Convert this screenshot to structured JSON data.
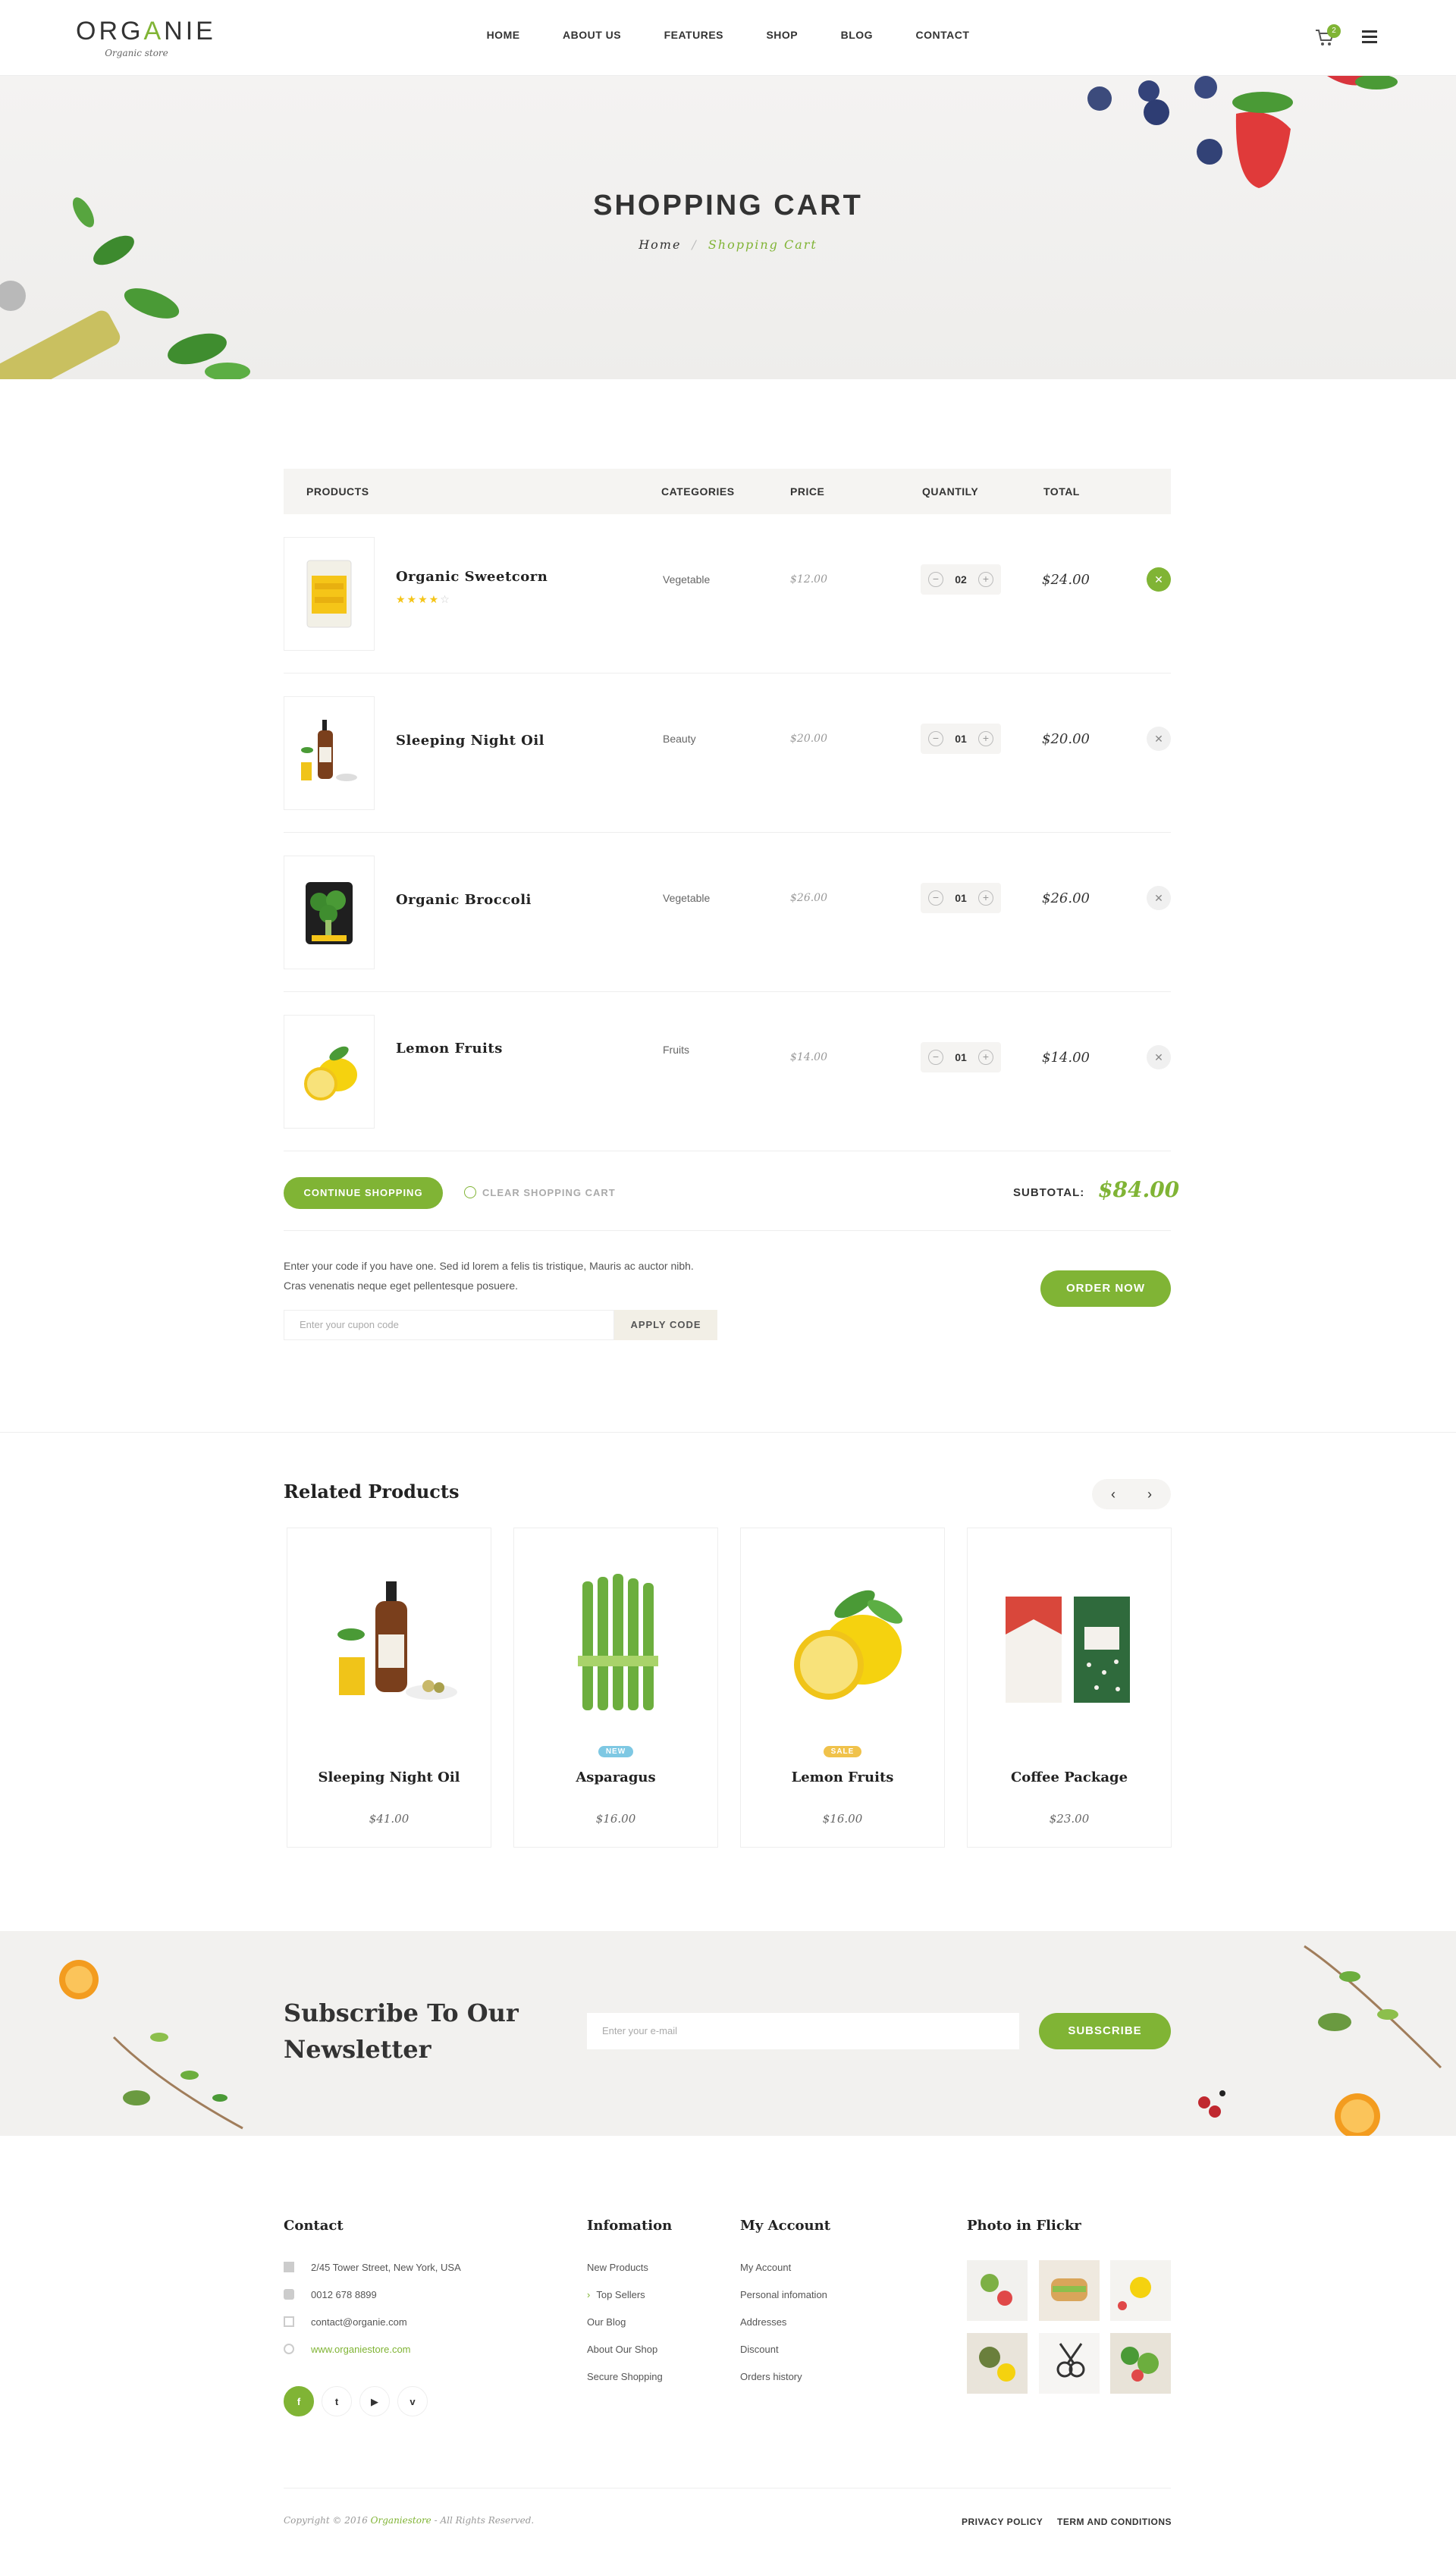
{
  "header": {
    "logo_part1": "ORG",
    "logo_accent": "A",
    "logo_part2": "NIE",
    "logo_tagline": "Organic store",
    "nav": [
      "HOME",
      "ABOUT US",
      "FEATURES",
      "SHOP",
      "BLOG",
      "CONTACT"
    ],
    "cart_count": "2"
  },
  "hero": {
    "title": "SHOPPING CART",
    "breadcrumb_home": "Home",
    "breadcrumb_sep": "/",
    "breadcrumb_current": "Shopping Cart"
  },
  "cart": {
    "columns": {
      "products": "PRODUCTS",
      "categories": "CATEGORIES",
      "price": "PRICE",
      "quantity": "QUANTILY",
      "total": "TOTAL"
    },
    "items": [
      {
        "name": "Organic Sweetcorn",
        "category": "Vegetable",
        "price": "$12.00",
        "qty": "02",
        "total": "$24.00",
        "rating": 4,
        "stars_on": "★★★★",
        "stars_off": "☆"
      },
      {
        "name": "Sleeping Night Oil",
        "category": "Beauty",
        "price": "$20.00",
        "qty": "01",
        "total": "$20.00"
      },
      {
        "name": "Organic Broccoli",
        "category": "Vegetable",
        "price": "$26.00",
        "qty": "01",
        "total": "$26.00"
      },
      {
        "name": "Lemon Fruits",
        "category": "Fruits",
        "price": "$14.00",
        "qty": "01",
        "total": "$14.00"
      }
    ],
    "continue_label": "CONTINUE SHOPPING",
    "clear_label": "CLEAR SHOPPING CART",
    "subtotal_label": "SUBTOTAL:",
    "subtotal_value": "$84.00",
    "coupon_text": "Enter your code if you have one. Sed id lorem a felis tis tristique, Mauris ac auctor nibh. Cras venenatis neque eget pellentesque posuere.",
    "coupon_placeholder": "Enter your cupon code",
    "apply_label": "APPLY CODE",
    "order_label": "ORDER NOW"
  },
  "related": {
    "title": "Related Products",
    "prev": "‹",
    "next": "›",
    "products": [
      {
        "name": "Sleeping Night Oil",
        "price": "$41.00",
        "badge": ""
      },
      {
        "name": "Asparagus",
        "price": "$16.00",
        "badge": "NEW"
      },
      {
        "name": "Lemon Fruits",
        "price": "$16.00",
        "badge": "SALE"
      },
      {
        "name": "Coffee Package",
        "price": "$23.00",
        "badge": ""
      }
    ]
  },
  "newsletter": {
    "title": "Subscribe To Our Newsletter",
    "placeholder": "Enter your e-mail",
    "button": "SUBSCRIBE"
  },
  "footer": {
    "contact_title": "Contact",
    "address": "2/45 Tower Street, New York, USA",
    "phone": "0012 678 8899",
    "email": "contact@organie.com",
    "website": "www.organiestore.com",
    "social": [
      "f",
      "t",
      "▶",
      "v"
    ],
    "info_title": "Infomation",
    "info_links": [
      "New Products",
      "Top Sellers",
      "Our Blog",
      "About Our Shop",
      "Secure Shopping"
    ],
    "account_title": "My Account",
    "account_links": [
      "My Account",
      "Personal infomation",
      "Addresses",
      "Discount",
      "Orders history"
    ],
    "flickr_title": "Photo in Flickr",
    "copyright_prefix": "Copyright © 2016 ",
    "copyright_brand": "Organiestore",
    "copyright_suffix": " - All Rights Reserved.",
    "privacy": "PRIVACY POLICY",
    "terms": "TERM AND CONDITIONS"
  },
  "colors": {
    "accent": "#80b435",
    "new_badge": "#7ec8e3",
    "sale_badge": "#f0c24b"
  }
}
